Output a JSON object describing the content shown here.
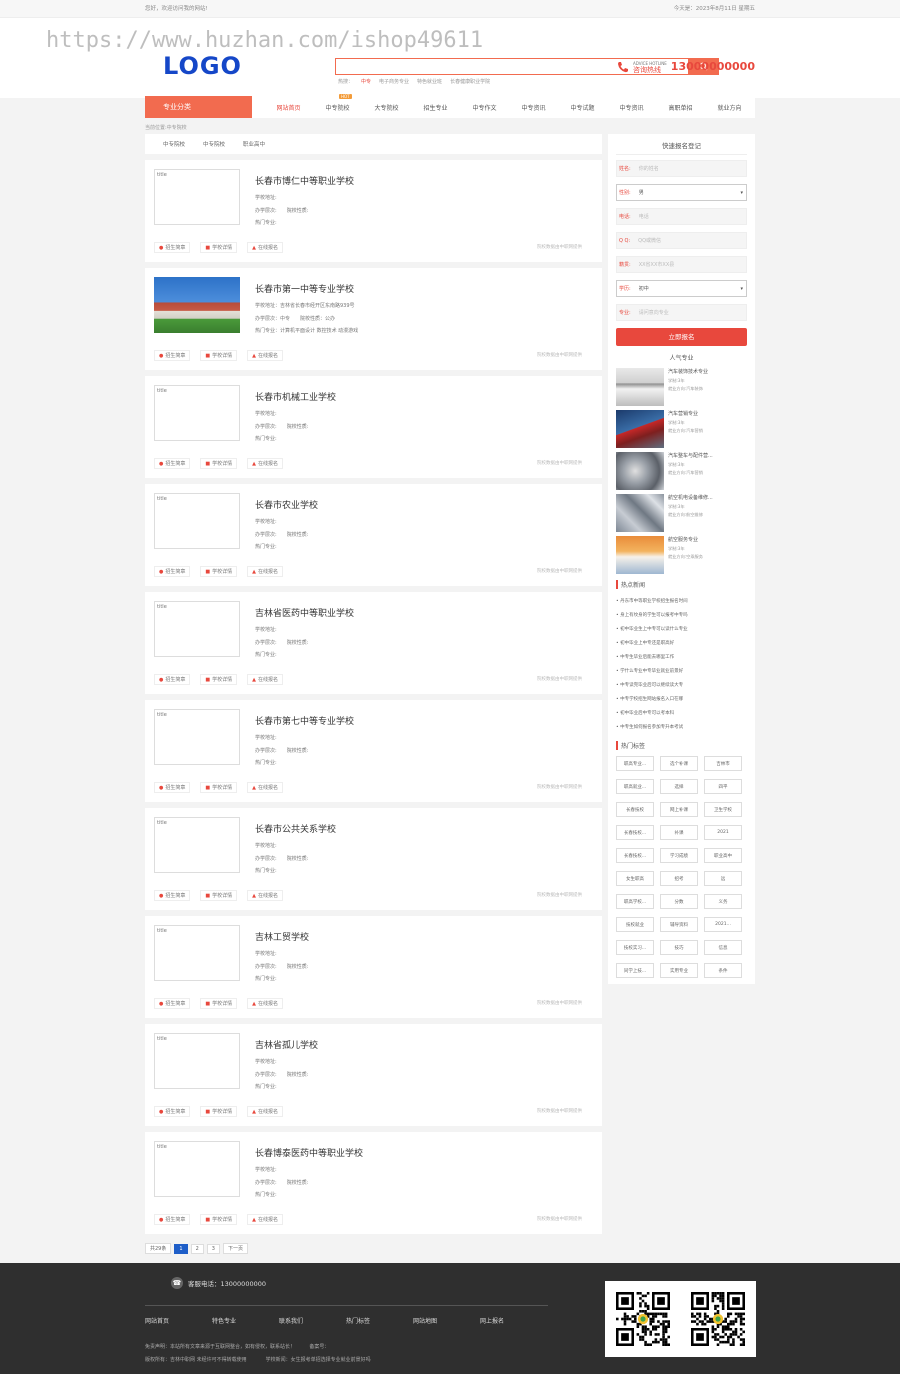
{
  "topbar": {
    "welcome": "您好，欢迎访问我的网站!",
    "date": "今天是：2023年8月11日 星期五"
  },
  "watermark": "https://www.huzhan.com/ishop49611",
  "header": {
    "logo": "LOGO",
    "search_placeholder": "",
    "hot_label": "热搜：",
    "hot": [
      "中专",
      "电子商务专业",
      "特色就业班",
      "长春健康职业学院"
    ],
    "hotline_label": "咨询热线",
    "hotline_sub": "ADVICE HOTLINE",
    "hotline": "13000000000"
  },
  "nav": {
    "category": "专业分类",
    "items": [
      "网站首页",
      "中专院校",
      "大专院校",
      "招生专业",
      "中专作文",
      "中专资讯",
      "中专试题",
      "中专资讯",
      "高职单招",
      "就业方向"
    ],
    "badge": "HOT"
  },
  "crumb": "当前位置:中专院校",
  "tabs": [
    "中专院校",
    "中专院校",
    "职业高中"
  ],
  "schools": [
    {
      "name": "长春市博仁中等职业学校",
      "img_alt": "title",
      "l1": "学校地址:",
      "l2a": "办学层次:",
      "l2b": "院校性质:",
      "l3": "热门专业:",
      "btn1": "招生简章",
      "btn2": "学校详情",
      "btn3": "在线报名",
      "note": "院校数据由中职网提供"
    },
    {
      "name": "长春市第一中等专业学校",
      "img_alt": "",
      "l1": "学校地址：吉林省长春市经开区东南路939号",
      "l2a": "办学层次：中专",
      "l2b": "院校性质：公办",
      "l3": "热门专业：计算机平面设计 数控技术 动漫游戏",
      "btn1": "招生简章",
      "btn2": "学校详情",
      "btn3": "在线报名",
      "note": "院校数据由中职网提供"
    },
    {
      "name": "长春市机械工业学校",
      "img_alt": "title",
      "l1": "学校地址:",
      "l2a": "办学层次:",
      "l2b": "院校性质:",
      "l3": "热门专业:",
      "btn1": "招生简章",
      "btn2": "学校详情",
      "btn3": "在线报名",
      "note": "院校数据由中职网提供"
    },
    {
      "name": "长春市农业学校",
      "img_alt": "title",
      "l1": "学校地址:",
      "l2a": "办学层次:",
      "l2b": "院校性质:",
      "l3": "热门专业:",
      "btn1": "招生简章",
      "btn2": "学校详情",
      "btn3": "在线报名",
      "note": "院校数据由中职网提供"
    },
    {
      "name": "吉林省医药中等职业学校",
      "img_alt": "title",
      "l1": "学校地址:",
      "l2a": "办学层次:",
      "l2b": "院校性质:",
      "l3": "热门专业:",
      "btn1": "招生简章",
      "btn2": "学校详情",
      "btn3": "在线报名",
      "note": "院校数据由中职网提供"
    },
    {
      "name": "长春市第七中等专业学校",
      "img_alt": "title",
      "l1": "学校地址:",
      "l2a": "办学层次:",
      "l2b": "院校性质:",
      "l3": "热门专业:",
      "btn1": "招生简章",
      "btn2": "学校详情",
      "btn3": "在线报名",
      "note": "院校数据由中职网提供"
    },
    {
      "name": "长春市公共关系学校",
      "img_alt": "title",
      "l1": "学校地址:",
      "l2a": "办学层次:",
      "l2b": "院校性质:",
      "l3": "热门专业:",
      "btn1": "招生简章",
      "btn2": "学校详情",
      "btn3": "在线报名",
      "note": "院校数据由中职网提供"
    },
    {
      "name": "吉林工贸学校",
      "img_alt": "title",
      "l1": "学校地址:",
      "l2a": "办学层次:",
      "l2b": "院校性质:",
      "l3": "热门专业:",
      "btn1": "招生简章",
      "btn2": "学校详情",
      "btn3": "在线报名",
      "note": "院校数据由中职网提供"
    },
    {
      "name": "吉林省孤儿学校",
      "img_alt": "title",
      "l1": "学校地址:",
      "l2a": "办学层次:",
      "l2b": "院校性质:",
      "l3": "热门专业:",
      "btn1": "招生简章",
      "btn2": "学校详情",
      "btn3": "在线报名",
      "note": "院校数据由中职网提供"
    },
    {
      "name": "长春博泰医药中等职业学校",
      "img_alt": "title",
      "l1": "学校地址:",
      "l2a": "办学层次:",
      "l2b": "院校性质:",
      "l3": "热门专业:",
      "btn1": "招生简章",
      "btn2": "学校详情",
      "btn3": "在线报名",
      "note": "院校数据由中职网提供"
    }
  ],
  "pager": {
    "total": "共29条",
    "pages": [
      "1",
      "2",
      "3"
    ],
    "next": "下一页"
  },
  "form": {
    "title": "快速报名登记",
    "name_k": "姓名:",
    "name_p": "你的姓名",
    "sex_k": "性别:",
    "sex_v": "男",
    "tel_k": "电话:",
    "tel_p": "电话",
    "qq_k": "Q Q:",
    "qq_p": "QQ或微信",
    "birth_k": "籍贯:",
    "birth_p": "XX省XX市XX县",
    "edu_k": "学历:",
    "edu_v": "初中",
    "major_k": "专业:",
    "major_p": "请问意向专业",
    "submit": "立即报名"
  },
  "popular": {
    "title": "人气专业",
    "items": [
      {
        "t": "汽车装饰技术专业",
        "a": "学制:3年",
        "b": "就业方向:汽车装饰"
      },
      {
        "t": "汽车营销专业",
        "a": "学制:3年",
        "b": "就业方向:汽车营销"
      },
      {
        "t": "汽车整车与配件营...",
        "a": "学制:3年",
        "b": "就业方向:汽车营销"
      },
      {
        "t": "航空机电设备维修...",
        "a": "学制:3年",
        "b": "就业方向:航空维修"
      },
      {
        "t": "航空服务专业",
        "a": "学制:3年",
        "b": "就业方向:空乘服务"
      }
    ]
  },
  "news": {
    "title": "热点新闻",
    "items": [
      "丹东市中等职业学校招生报名时间",
      "身上有纹身的学生可以报考中专吗",
      "初中毕业生上中专可以读什么专业",
      "初中毕业上中专还是职高好",
      "中专生毕业后能去哪里工作",
      "学什么专业中专毕业就业前景好",
      "中专读完毕业后可以继续读大专",
      "中专学校招生网站报名入口在哪",
      "初中毕业后中专可以考本科",
      "中专生如何报名参加专升本考试"
    ]
  },
  "tags": {
    "title": "热门标签",
    "items": [
      "职高专业...",
      "选个补课",
      "吉林市",
      "职高就业...",
      "选择",
      "四平",
      "长春技校",
      "网上补课",
      "卫生学校",
      "长春技校...",
      "补课",
      "2021",
      "长春技校...",
      "学习成绩",
      "职业高中",
      "女生职高",
      "招考",
      "远",
      "职高学校...",
      "分数",
      "义务",
      "技校就业",
      "辅导资料",
      "2021...",
      "技校实习...",
      "技巧",
      "信息",
      "同学上技...",
      "实用专业",
      "条件"
    ]
  },
  "footer": {
    "tel": "客服电话：13000000000",
    "links": [
      "网站首页",
      "特色专业",
      "联系我们",
      "热门标签",
      "网站地图",
      "网上报名"
    ],
    "c1": "免责声明：本站所有文章来源于互联网整合，如有侵权，联系站长！",
    "c1b": "备案号：",
    "c2": "版权所有：吉林中职网 未经许可不得转载使用",
    "c2b": "学校新闻：女生报考单招选择专业就业前景好吗"
  }
}
